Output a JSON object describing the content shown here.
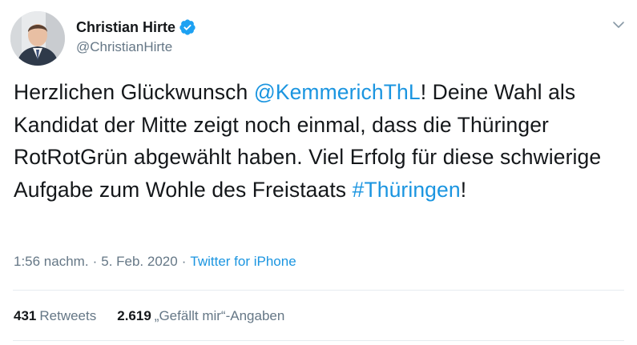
{
  "author": {
    "display_name": "Christian Hirte",
    "handle": "@ChristianHirte",
    "verified": true
  },
  "tweet": {
    "text_before_mention": "Herzlichen Glückwunsch ",
    "mention": "@KemmerichThL",
    "text_middle": "! Deine Wahl als Kandidat der Mitte zeigt noch einmal, dass die Thüringer RotRotGrün abgewählt haben. Viel Erfolg für diese schwierige Aufgabe zum Wohle des Freistaats ",
    "hashtag": "#Thüringen",
    "text_after_hashtag": "!"
  },
  "meta": {
    "time": "1:56 nachm.",
    "separator": "·",
    "date": "5. Feb. 2020",
    "source": "Twitter for iPhone"
  },
  "stats": {
    "retweets_count": "431",
    "retweets_label": "Retweets",
    "likes_count": "2.619",
    "likes_label": "„Gefällt mir“-Angaben"
  },
  "icons": {
    "verified": "verified-badge-icon",
    "menu": "chevron-down-icon"
  },
  "colors": {
    "link": "#1b95e0",
    "secondary_text": "#657786",
    "verified": "#1da1f2"
  }
}
